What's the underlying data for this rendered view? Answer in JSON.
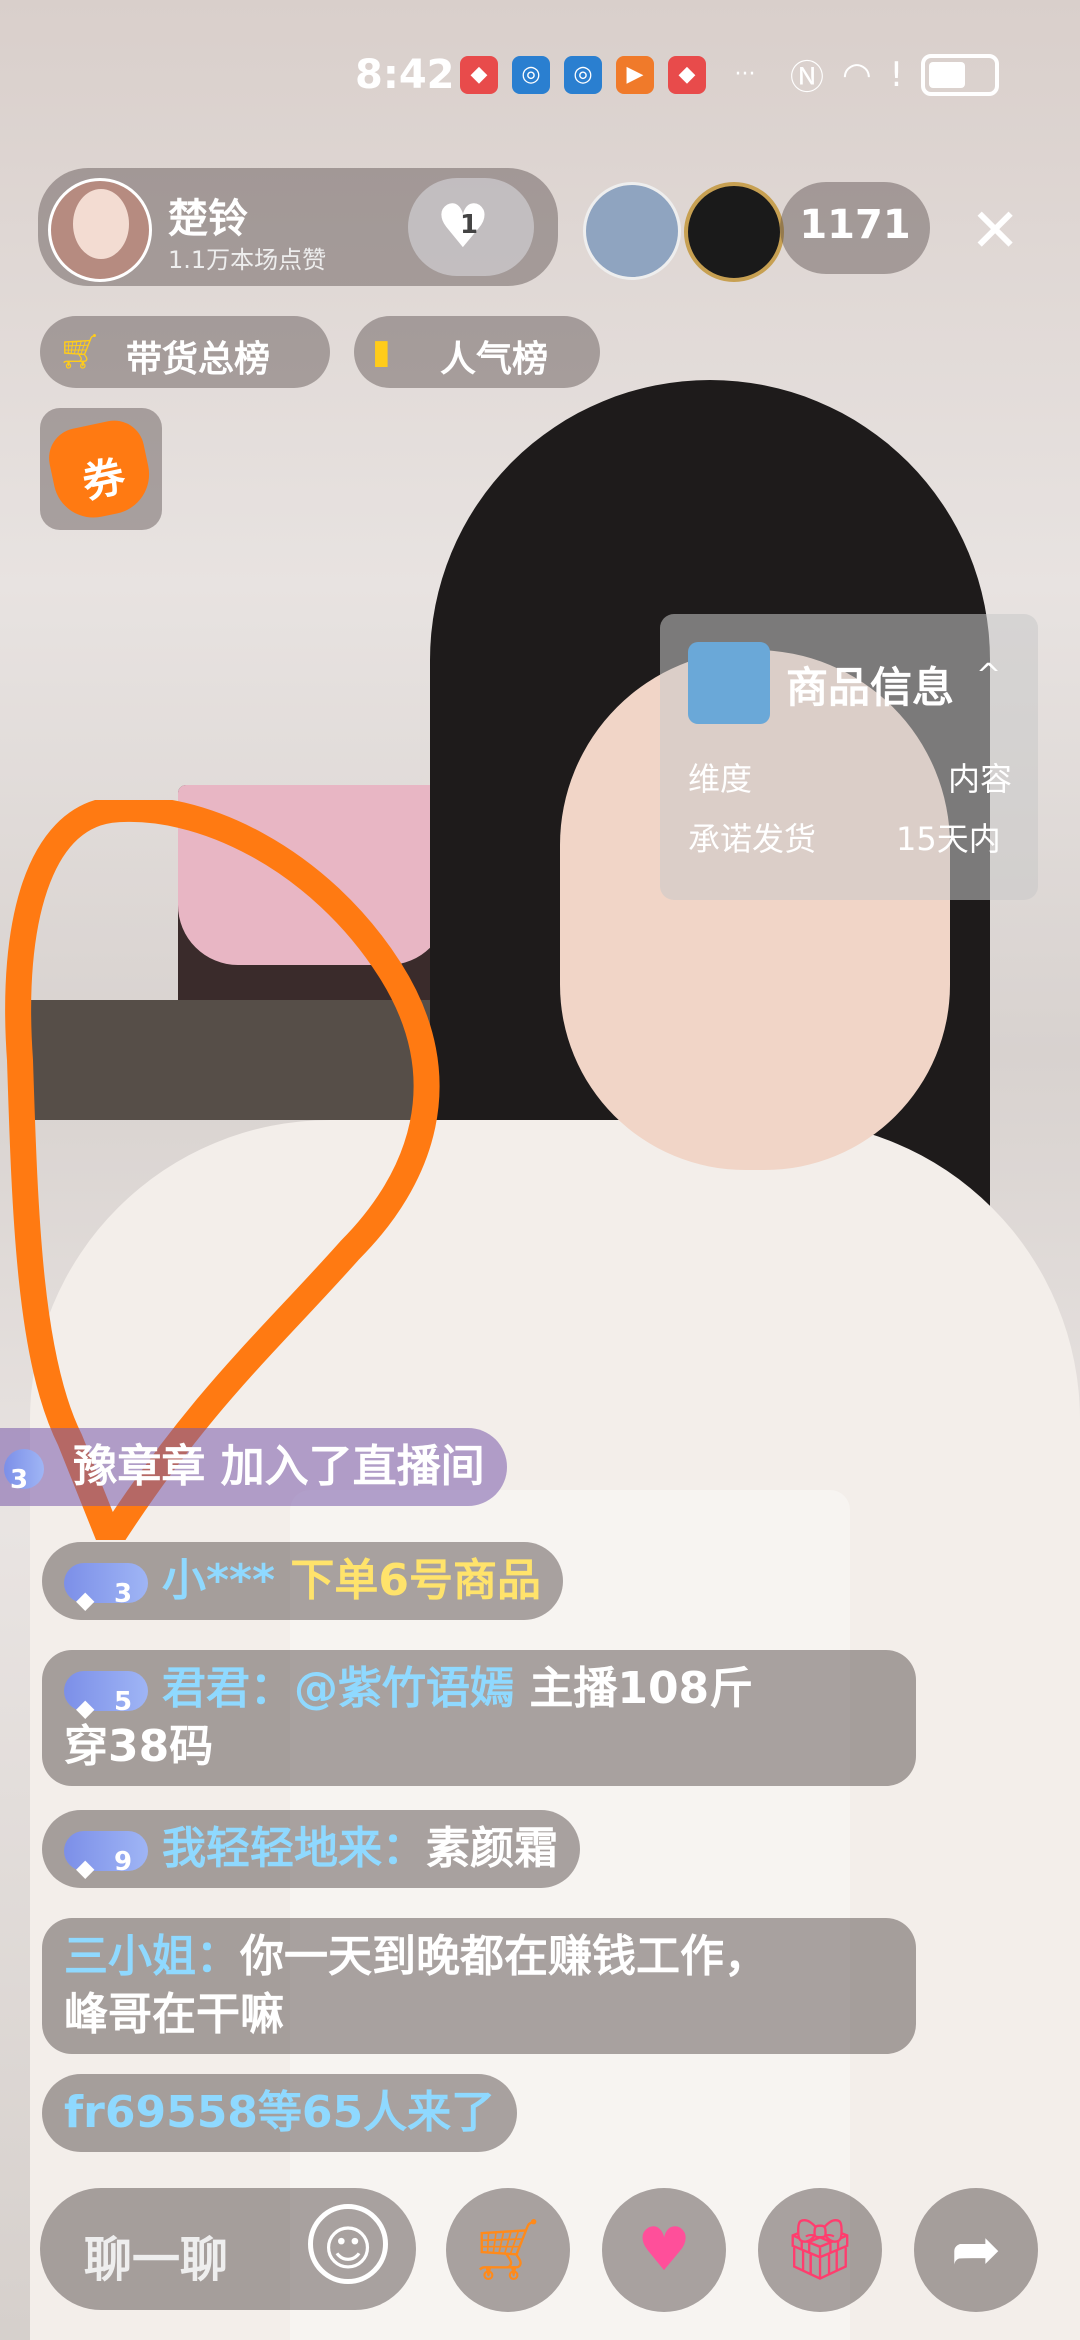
{
  "status_bar": {
    "time": "8:42",
    "app_icons": [
      "huawei-icon",
      "globe-icon",
      "globe-icon",
      "video-icon",
      "huawei-icon"
    ],
    "more": "···"
  },
  "host": {
    "name": "楚铃",
    "likes": "1.1万本场点赞",
    "heart_count": "1"
  },
  "viewer_count": "1171",
  "ranks": [
    {
      "label": "带货总榜",
      "icon": "cart-icon"
    },
    {
      "label": "人气榜",
      "icon": "bar-chart-icon"
    }
  ],
  "coupon": {
    "label": "券"
  },
  "product_info": {
    "title": "商品信息",
    "col1_header": "维度",
    "col2_header": "内容",
    "row_key": "承诺发货",
    "row_value": "15天内"
  },
  "join_notice": {
    "badge": "3",
    "user": "豫章章",
    "text": "加入了直播间"
  },
  "messages": [
    {
      "badge": "3",
      "user": "小***",
      "text": "下单6号商品"
    },
    {
      "badge": "5",
      "user": "君君：",
      "mention": "@紫竹语嫣",
      "text": "主播108斤",
      "text2": "穿38码"
    },
    {
      "badge": "9",
      "user": "我轻轻地来：",
      "text": "素颜霜"
    },
    {
      "user": "三小姐：",
      "text": "你一天到晚都在赚钱工作，",
      "text2": "峰哥在干嘛"
    },
    {
      "user": "fr69558等65人来了"
    }
  ],
  "bottom": {
    "chat_placeholder": "聊一聊",
    "buttons": [
      "shopping-cart-icon",
      "heart-icon",
      "gift-icon",
      "share-icon"
    ]
  },
  "colors": {
    "username": "#8fd9ff",
    "highlight": "#ffe36b",
    "annotation": "#ff7a12"
  }
}
